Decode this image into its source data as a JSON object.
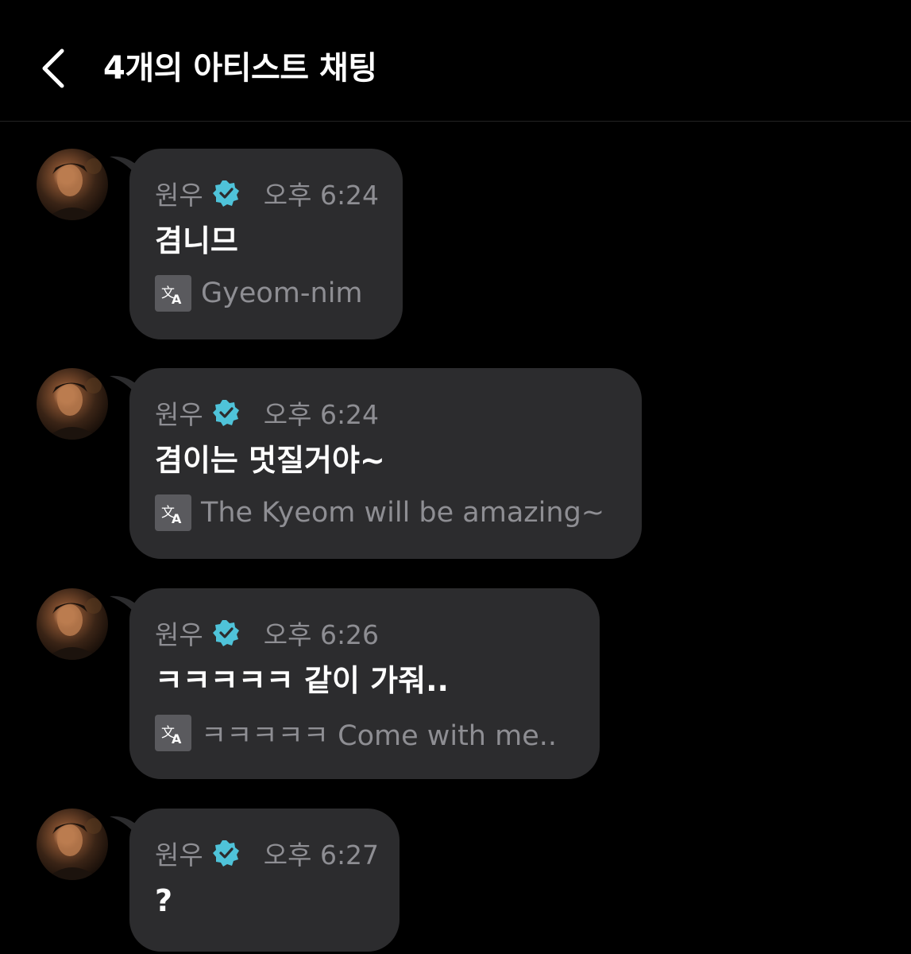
{
  "header": {
    "title": "4개의 아티스트 채팅",
    "back_icon": "chevron-left-icon"
  },
  "colors": {
    "background": "#000000",
    "bubble": "#2c2c2e",
    "meta_text": "#8e8e93",
    "verified": "#4fc3d9"
  },
  "messages": [
    {
      "sender": "원우",
      "time": "오후 6:24",
      "text": "겸니므",
      "translation": "Gyeom-nim"
    },
    {
      "sender": "원우",
      "time": "오후 6:24",
      "text": "겸이는 멋질거야~",
      "translation": "The Kyeom will be amazing~"
    },
    {
      "sender": "원우",
      "time": "오후 6:26",
      "text": "ㅋㅋㅋㅋㅋ 같이 가줘..",
      "translation": "ㅋㅋㅋㅋㅋ Come with me.."
    },
    {
      "sender": "원우",
      "time": "오후 6:27",
      "text": "?",
      "translation": ""
    }
  ]
}
